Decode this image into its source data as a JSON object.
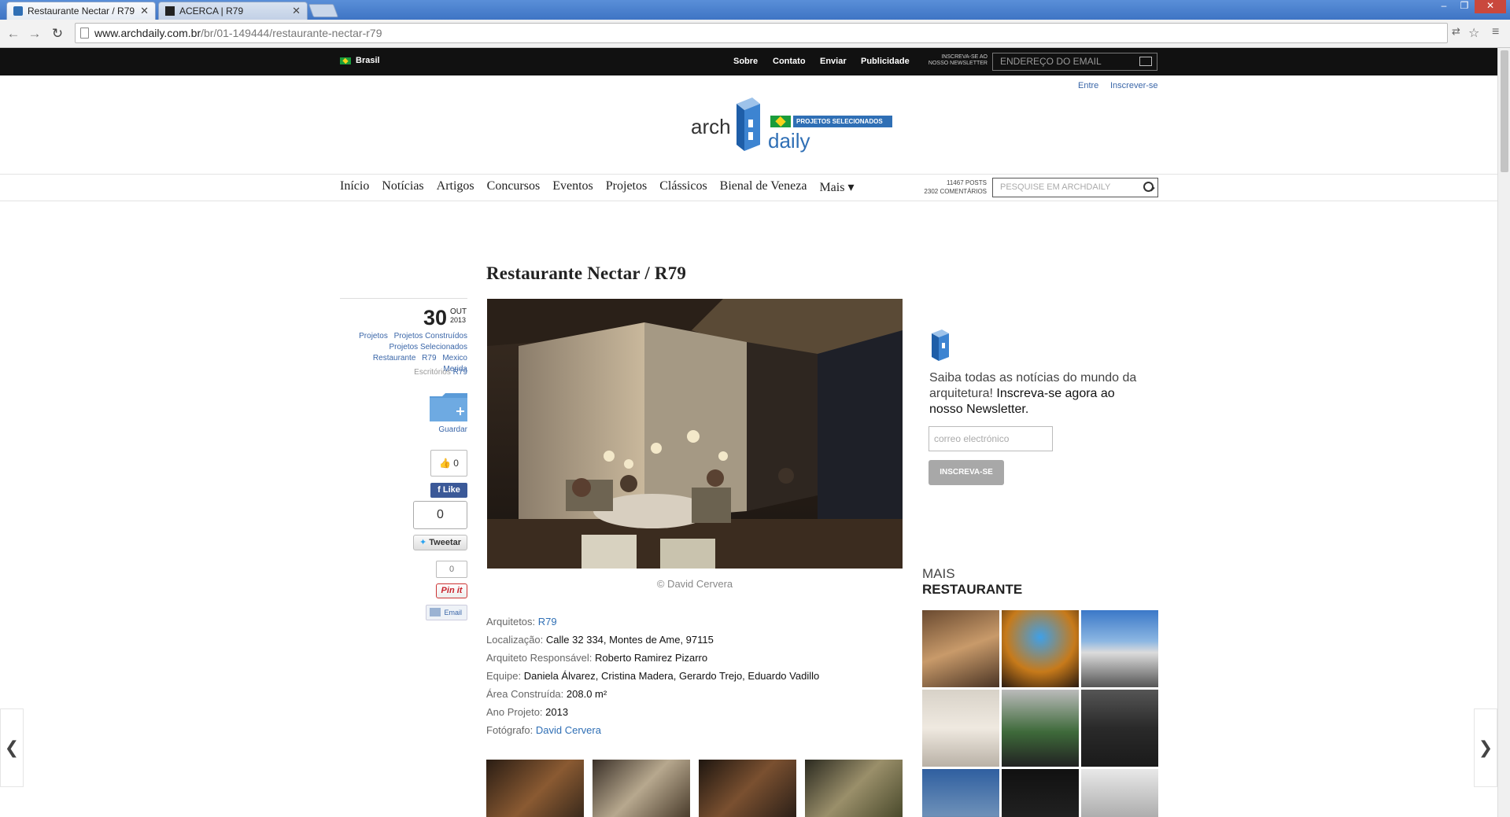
{
  "browser": {
    "tabs": [
      {
        "title": "Restaurante Nectar / R79",
        "active": true
      },
      {
        "title": "ACERCA | R79",
        "active": false
      }
    ],
    "url_host": "www.archdaily.com.br",
    "url_path": "/br/01-149444/restaurante-nectar-r79"
  },
  "topbar": {
    "country": "Brasil",
    "links": [
      "Sobre",
      "Contato",
      "Enviar",
      "Publicidade"
    ],
    "newsletter_label": "INSCREVA-SE AO NOSSO NEWSLETTER",
    "newsletter_placeholder": "ENDEREÇO DO EMAIL"
  },
  "user": {
    "login": "Entre",
    "signup": "Inscrever-se"
  },
  "logo": {
    "arch": "arch",
    "daily": "daily",
    "badge": "PROJETOS SELECIONADOS"
  },
  "nav": {
    "items": [
      "Início",
      "Notícias",
      "Artigos",
      "Concursos",
      "Eventos",
      "Projetos",
      "Clássicos",
      "Bienal de Veneza",
      "Mais ▾"
    ],
    "stats_posts": "11467 POSTS",
    "stats_comments": "2302 COMENTÁRIOS",
    "search_placeholder": "PESQUISE EM ARCHDAILY"
  },
  "article": {
    "title": "Restaurante Nectar / R79",
    "day": "30",
    "month": "OUT",
    "year": "2013",
    "tags_line1": [
      "Projetos",
      "Projetos Construídos"
    ],
    "tags_line2": [
      "Projetos Selecionados"
    ],
    "tags_line3": [
      "Restaurante",
      "R79",
      "Mexico",
      "Merida"
    ],
    "offices_label": "Escritórios",
    "offices_value": "R79",
    "save": "Guardar",
    "like_count": "0",
    "fb_like": "Like",
    "tweet_count": "0",
    "tweet": "Tweetar",
    "pin_count": "0",
    "pin": "Pin it",
    "email": "Email",
    "photo_credit": "© David Cervera",
    "specs": [
      {
        "label": "Arquitetos:",
        "value": "R79",
        "link": true
      },
      {
        "label": "Localização:",
        "value": "Calle 32 334, Montes de Ame, 97115",
        "link": false
      },
      {
        "label": "Arquiteto Responsável:",
        "value": "Roberto Ramirez Pizarro",
        "link": false
      },
      {
        "label": "Equipe:",
        "value": "Daniela Álvarez, Cristina Madera, Gerardo Trejo, Eduardo Vadillo",
        "link": false
      },
      {
        "label": "Área Construída:",
        "value": "208.0 m²",
        "link": false
      },
      {
        "label": "Ano Projeto:",
        "value": "2013",
        "link": false
      },
      {
        "label": "Fotógrafo:",
        "value": "David Cervera",
        "link": true
      }
    ]
  },
  "sidebar": {
    "nl_text_a": "Saiba todas as notícias do mundo da arquitetura!",
    "nl_text_b": "Inscreva-se agora ao nosso Newsletter.",
    "nl_placeholder": "correo electrónico",
    "nl_button": "INSCREVA-SE",
    "more_label": "MAIS",
    "more_category": "RESTAURANTE"
  },
  "pager": {
    "prev": "❮",
    "next": "❯"
  }
}
